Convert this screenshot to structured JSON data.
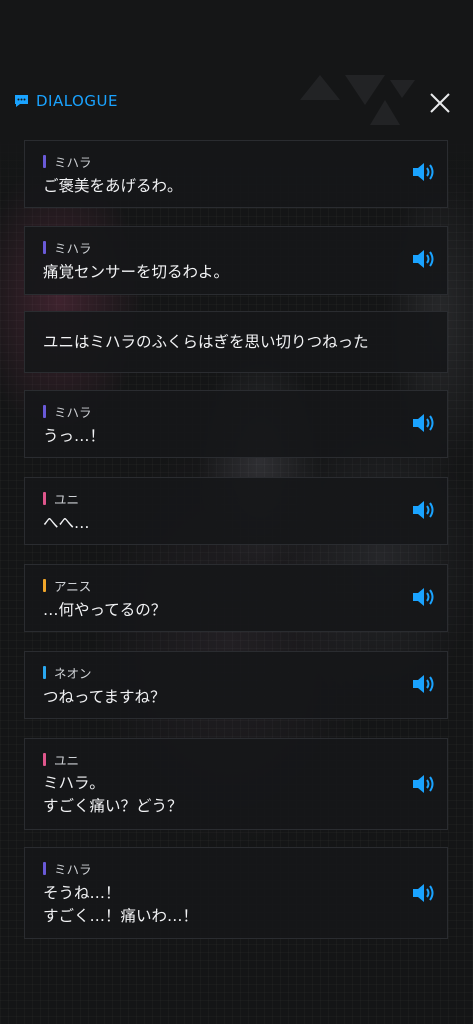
{
  "header": {
    "title": "DIALOGUE"
  },
  "colors": {
    "accent": "#1aa3ff",
    "mihara": "#6a5ad8",
    "yuni": "#e0568c",
    "anis": "#f0a62a",
    "neon": "#2aa8f0"
  },
  "dialogue": [
    {
      "speaker": "ミハラ",
      "text": "ご褒美をあげるわ。"
    },
    {
      "speaker": "ミハラ",
      "text": "痛覚センサーを切るわよ。"
    },
    {
      "narration": "ユニはミハラのふくらはぎを思い切りつねった"
    },
    {
      "speaker": "ミハラ",
      "text": "うっ…！"
    },
    {
      "speaker": "ユニ",
      "text": "へへ…"
    },
    {
      "speaker": "アニス",
      "text": "…何やってるの？"
    },
    {
      "speaker": "ネオン",
      "text": "つねってますね？"
    },
    {
      "speaker": "ユニ",
      "text": "ミハラ。\nすごく痛い？どう？"
    },
    {
      "speaker": "ミハラ",
      "text": "そうね…！\nすごく…！痛いわ…！"
    }
  ]
}
